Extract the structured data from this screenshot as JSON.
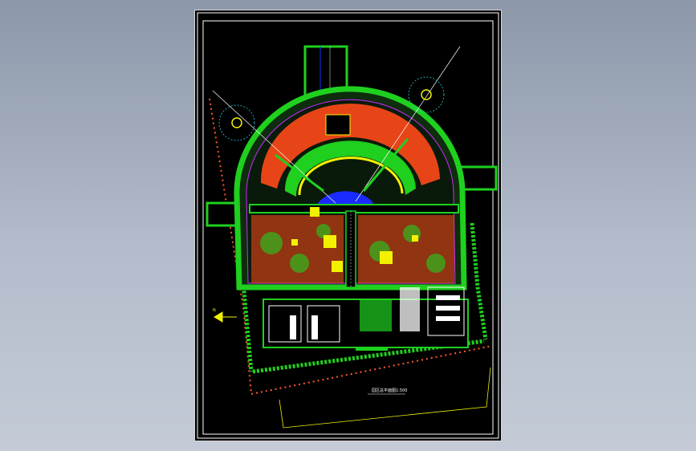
{
  "drawing": {
    "title_text": "园区总平面图",
    "scale_text": "1:500",
    "north_arrow_label": "N",
    "colors": {
      "background": "#000000",
      "frame": "#ffffff",
      "planting": "#1fd01f",
      "planting_dark": "#0a9a0a",
      "buildings": "#ff4a1a",
      "paving": "#f2f200",
      "water": "#1a2bff",
      "road_line": "#cfcfcf",
      "boundary": "#cc2aff",
      "boundary_dots": "#ff5a2a",
      "annotation": "#ffffff",
      "cyan": "#22d3e6"
    }
  }
}
